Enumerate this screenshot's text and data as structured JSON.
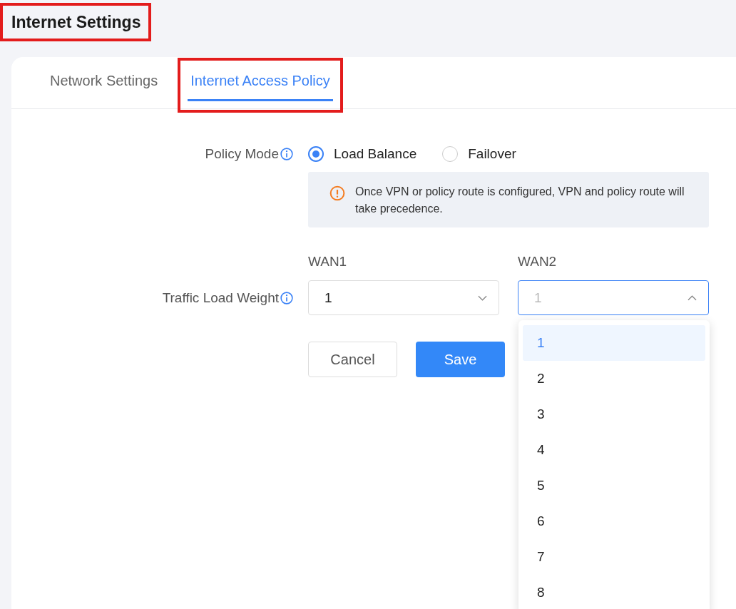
{
  "page_title": {
    "text": "Internet Settings",
    "highlighted": true
  },
  "tabs": [
    {
      "label": "Network Settings",
      "selected": false,
      "highlighted": false
    },
    {
      "label": "Internet Access Policy",
      "selected": true,
      "highlighted": true
    }
  ],
  "policy_mode": {
    "label": "Policy Mode",
    "options": [
      {
        "label": "Load Balance",
        "selected": true
      },
      {
        "label": "Failover",
        "selected": false
      }
    ]
  },
  "notice": "Once VPN or policy route is configured, VPN and policy route will take precedence.",
  "traffic_load_weight": {
    "label": "Traffic Load Weight",
    "selects": [
      {
        "label": "WAN1",
        "value": "1",
        "open": false
      },
      {
        "label": "WAN2",
        "value": "1",
        "open": true
      }
    ]
  },
  "dropdown_options": [
    {
      "label": "1",
      "selected": true
    },
    {
      "label": "2",
      "selected": false
    },
    {
      "label": "3",
      "selected": false
    },
    {
      "label": "4",
      "selected": false
    },
    {
      "label": "5",
      "selected": false
    },
    {
      "label": "6",
      "selected": false
    },
    {
      "label": "7",
      "selected": false
    },
    {
      "label": "8",
      "selected": false
    }
  ],
  "buttons": [
    {
      "label": "Cancel",
      "kind": "secondary"
    },
    {
      "label": "Save",
      "kind": "primary"
    }
  ]
}
